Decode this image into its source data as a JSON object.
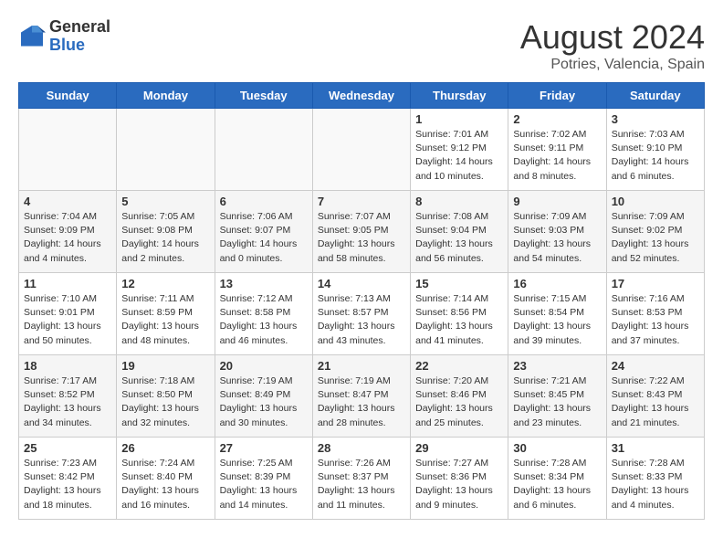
{
  "logo": {
    "general": "General",
    "blue": "Blue"
  },
  "header": {
    "month": "August 2024",
    "location": "Potries, Valencia, Spain"
  },
  "weekdays": [
    "Sunday",
    "Monday",
    "Tuesday",
    "Wednesday",
    "Thursday",
    "Friday",
    "Saturday"
  ],
  "weeks": [
    [
      {
        "day": "",
        "info": ""
      },
      {
        "day": "",
        "info": ""
      },
      {
        "day": "",
        "info": ""
      },
      {
        "day": "",
        "info": ""
      },
      {
        "day": "1",
        "info": "Sunrise: 7:01 AM\nSunset: 9:12 PM\nDaylight: 14 hours\nand 10 minutes."
      },
      {
        "day": "2",
        "info": "Sunrise: 7:02 AM\nSunset: 9:11 PM\nDaylight: 14 hours\nand 8 minutes."
      },
      {
        "day": "3",
        "info": "Sunrise: 7:03 AM\nSunset: 9:10 PM\nDaylight: 14 hours\nand 6 minutes."
      }
    ],
    [
      {
        "day": "4",
        "info": "Sunrise: 7:04 AM\nSunset: 9:09 PM\nDaylight: 14 hours\nand 4 minutes."
      },
      {
        "day": "5",
        "info": "Sunrise: 7:05 AM\nSunset: 9:08 PM\nDaylight: 14 hours\nand 2 minutes."
      },
      {
        "day": "6",
        "info": "Sunrise: 7:06 AM\nSunset: 9:07 PM\nDaylight: 14 hours\nand 0 minutes."
      },
      {
        "day": "7",
        "info": "Sunrise: 7:07 AM\nSunset: 9:05 PM\nDaylight: 13 hours\nand 58 minutes."
      },
      {
        "day": "8",
        "info": "Sunrise: 7:08 AM\nSunset: 9:04 PM\nDaylight: 13 hours\nand 56 minutes."
      },
      {
        "day": "9",
        "info": "Sunrise: 7:09 AM\nSunset: 9:03 PM\nDaylight: 13 hours\nand 54 minutes."
      },
      {
        "day": "10",
        "info": "Sunrise: 7:09 AM\nSunset: 9:02 PM\nDaylight: 13 hours\nand 52 minutes."
      }
    ],
    [
      {
        "day": "11",
        "info": "Sunrise: 7:10 AM\nSunset: 9:01 PM\nDaylight: 13 hours\nand 50 minutes."
      },
      {
        "day": "12",
        "info": "Sunrise: 7:11 AM\nSunset: 8:59 PM\nDaylight: 13 hours\nand 48 minutes."
      },
      {
        "day": "13",
        "info": "Sunrise: 7:12 AM\nSunset: 8:58 PM\nDaylight: 13 hours\nand 46 minutes."
      },
      {
        "day": "14",
        "info": "Sunrise: 7:13 AM\nSunset: 8:57 PM\nDaylight: 13 hours\nand 43 minutes."
      },
      {
        "day": "15",
        "info": "Sunrise: 7:14 AM\nSunset: 8:56 PM\nDaylight: 13 hours\nand 41 minutes."
      },
      {
        "day": "16",
        "info": "Sunrise: 7:15 AM\nSunset: 8:54 PM\nDaylight: 13 hours\nand 39 minutes."
      },
      {
        "day": "17",
        "info": "Sunrise: 7:16 AM\nSunset: 8:53 PM\nDaylight: 13 hours\nand 37 minutes."
      }
    ],
    [
      {
        "day": "18",
        "info": "Sunrise: 7:17 AM\nSunset: 8:52 PM\nDaylight: 13 hours\nand 34 minutes."
      },
      {
        "day": "19",
        "info": "Sunrise: 7:18 AM\nSunset: 8:50 PM\nDaylight: 13 hours\nand 32 minutes."
      },
      {
        "day": "20",
        "info": "Sunrise: 7:19 AM\nSunset: 8:49 PM\nDaylight: 13 hours\nand 30 minutes."
      },
      {
        "day": "21",
        "info": "Sunrise: 7:19 AM\nSunset: 8:47 PM\nDaylight: 13 hours\nand 28 minutes."
      },
      {
        "day": "22",
        "info": "Sunrise: 7:20 AM\nSunset: 8:46 PM\nDaylight: 13 hours\nand 25 minutes."
      },
      {
        "day": "23",
        "info": "Sunrise: 7:21 AM\nSunset: 8:45 PM\nDaylight: 13 hours\nand 23 minutes."
      },
      {
        "day": "24",
        "info": "Sunrise: 7:22 AM\nSunset: 8:43 PM\nDaylight: 13 hours\nand 21 minutes."
      }
    ],
    [
      {
        "day": "25",
        "info": "Sunrise: 7:23 AM\nSunset: 8:42 PM\nDaylight: 13 hours\nand 18 minutes."
      },
      {
        "day": "26",
        "info": "Sunrise: 7:24 AM\nSunset: 8:40 PM\nDaylight: 13 hours\nand 16 minutes."
      },
      {
        "day": "27",
        "info": "Sunrise: 7:25 AM\nSunset: 8:39 PM\nDaylight: 13 hours\nand 14 minutes."
      },
      {
        "day": "28",
        "info": "Sunrise: 7:26 AM\nSunset: 8:37 PM\nDaylight: 13 hours\nand 11 minutes."
      },
      {
        "day": "29",
        "info": "Sunrise: 7:27 AM\nSunset: 8:36 PM\nDaylight: 13 hours\nand 9 minutes."
      },
      {
        "day": "30",
        "info": "Sunrise: 7:28 AM\nSunset: 8:34 PM\nDaylight: 13 hours\nand 6 minutes."
      },
      {
        "day": "31",
        "info": "Sunrise: 7:28 AM\nSunset: 8:33 PM\nDaylight: 13 hours\nand 4 minutes."
      }
    ]
  ]
}
